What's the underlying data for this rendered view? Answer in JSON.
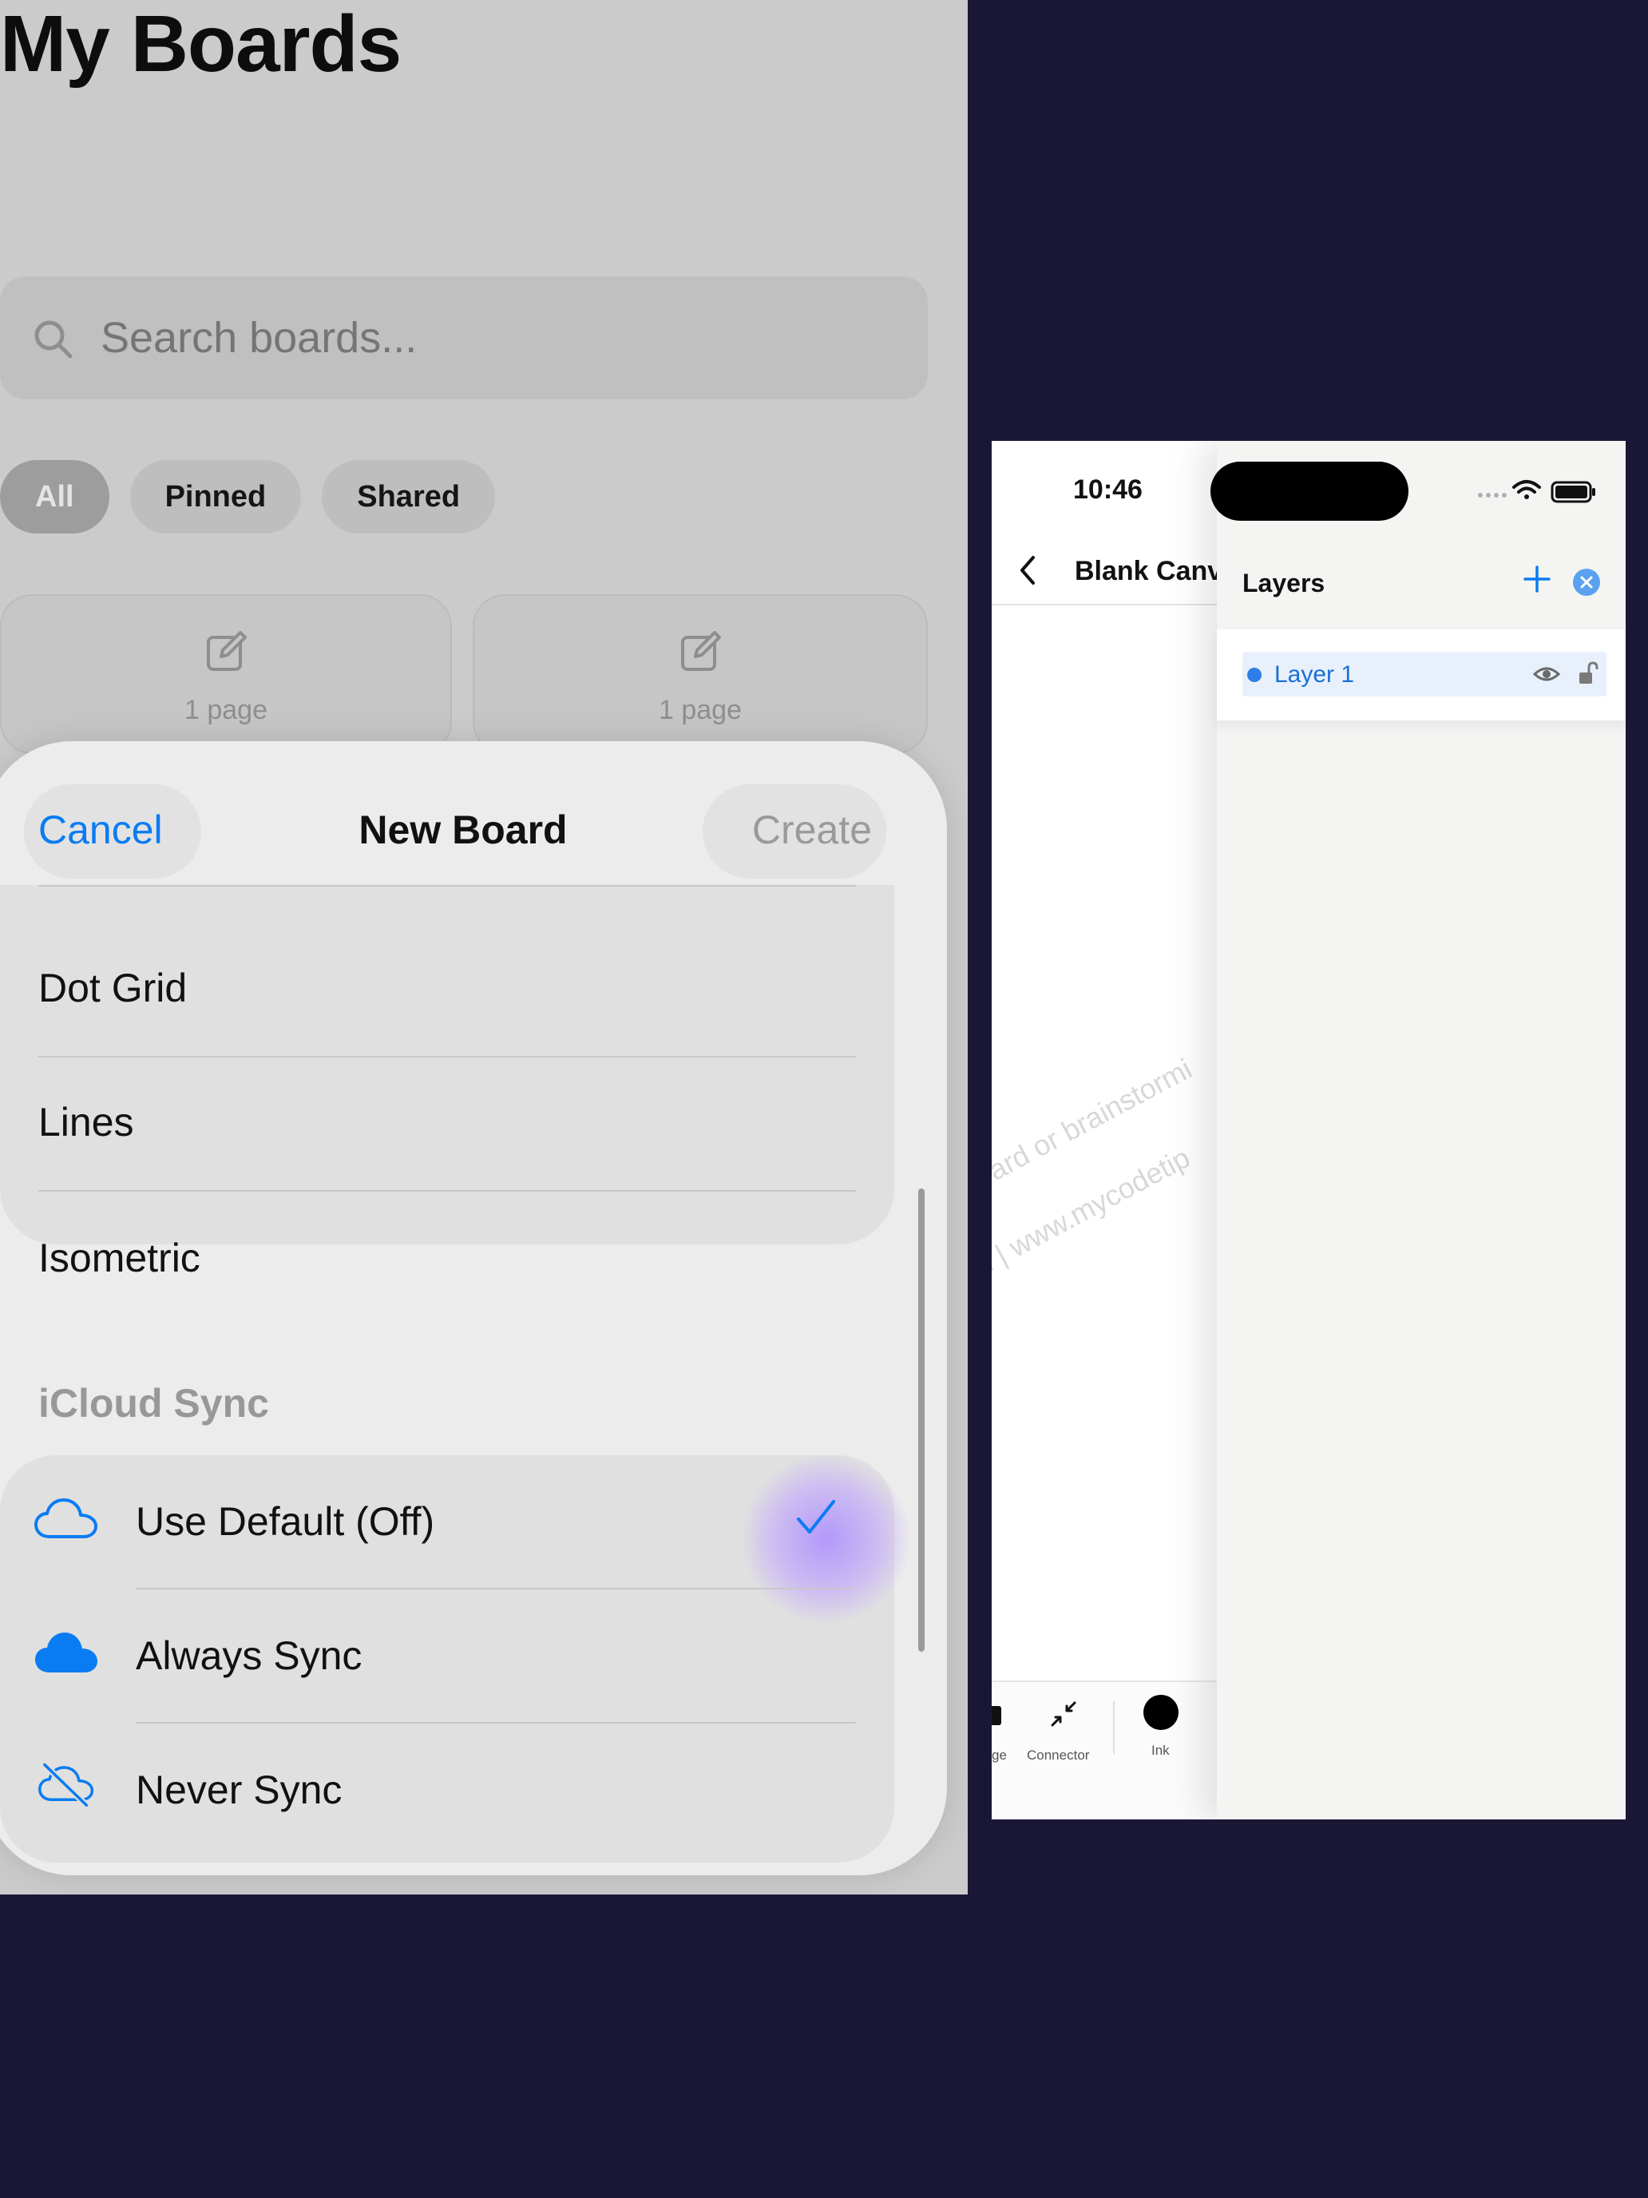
{
  "boards": {
    "title": "My Boards",
    "search_placeholder": "Search boards...",
    "filters": [
      "All",
      "Pinned",
      "Shared"
    ],
    "cards": [
      {
        "pages": "1 page"
      },
      {
        "pages": "1 page"
      }
    ]
  },
  "sheet": {
    "cancel_label": "Cancel",
    "title": "New Board",
    "create_label": "Create",
    "paper_styles": [
      "Dot Grid",
      "Lines",
      "Isometric"
    ],
    "sync_section_label": "iCloud Sync",
    "sync_options": [
      {
        "label": "Use Default (Off)",
        "icon": "cloud-outline-icon",
        "selected": true
      },
      {
        "label": "Always Sync",
        "icon": "cloud-filled-icon",
        "selected": false
      },
      {
        "label": "Never Sync",
        "icon": "cloud-slash-icon",
        "selected": false
      }
    ]
  },
  "canvas": {
    "status_time": "10:46",
    "title": "Blank Canva",
    "watermark_lines": [
      "oard or brainstormi",
      "n | www.mycodetip"
    ],
    "toolbar": {
      "partial_label": "ge",
      "connector_label": "Connector",
      "ink_label": "Ink"
    },
    "layers": {
      "title": "Layers",
      "items": [
        {
          "name": "Layer 1",
          "visible": true,
          "locked": false,
          "selected": true
        }
      ]
    }
  },
  "colors": {
    "accent": "#0a7cf2",
    "background": "#1a1736",
    "purple_glow": "#b9a3ff"
  }
}
